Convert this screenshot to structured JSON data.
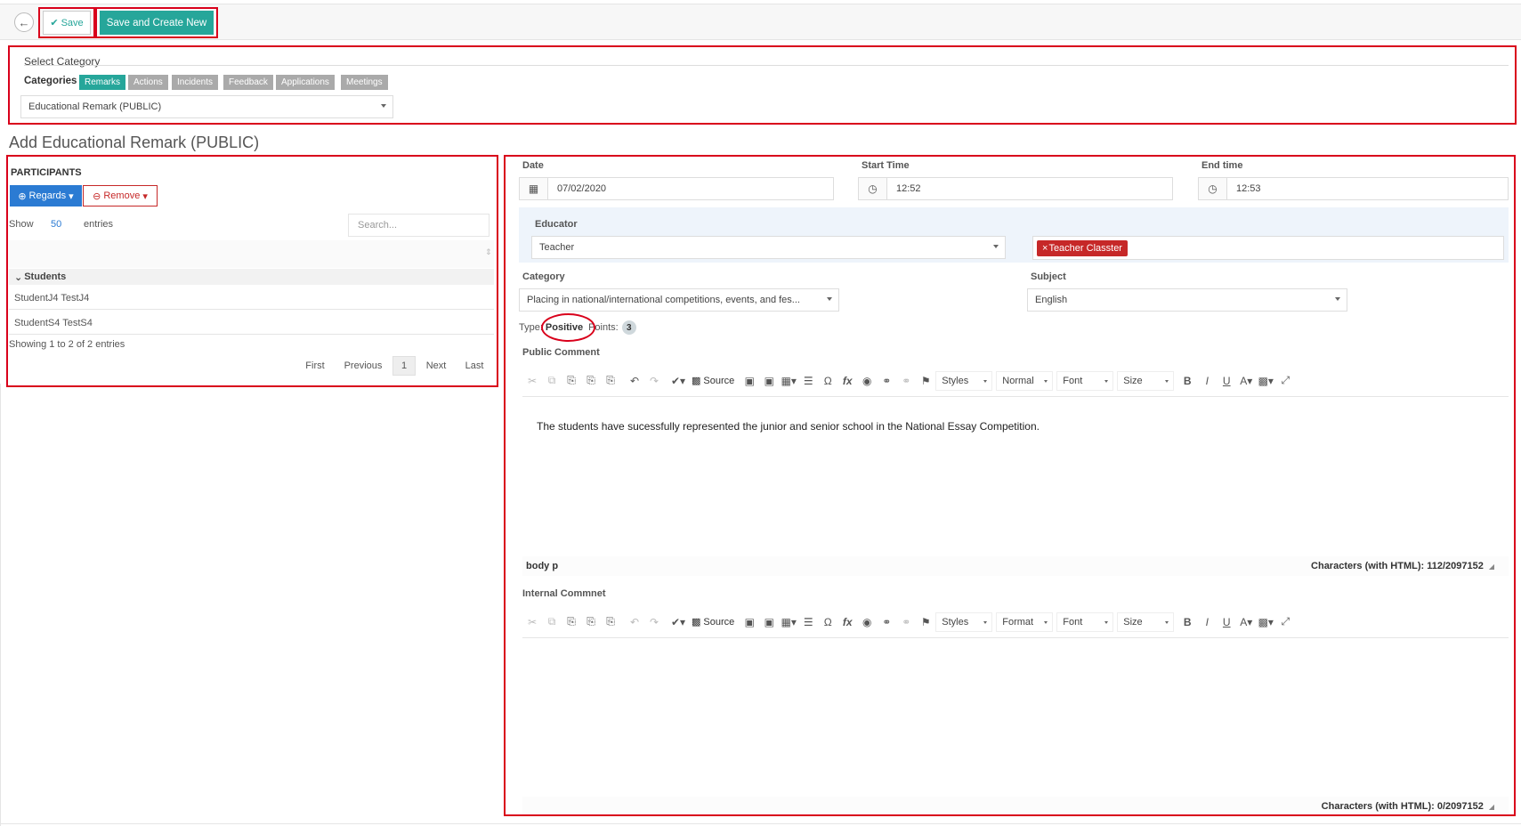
{
  "toolbar": {
    "back_icon": "arrow-left-icon",
    "save_label": "Save",
    "save_new_label": "Save and Create New"
  },
  "category_section": {
    "title": "Select Category",
    "categories_label": "Categories",
    "tabs": [
      "Remarks",
      "Actions",
      "Incidents",
      "Feedback",
      "Applications",
      "Meetings"
    ],
    "active_tab": "Remarks",
    "selected": "Educational Remark (PUBLIC)"
  },
  "page_title": "Add Educational Remark (PUBLIC)",
  "participants": {
    "title": "PARTICIPANTS",
    "regards_label": "Regards",
    "remove_label": "Remove",
    "show_label": "Show",
    "show_value": "50",
    "entries_label": "entries",
    "search_placeholder": "Search...",
    "group": "Students",
    "rows": [
      "StudentJ4 TestJ4",
      "StudentS4 TestS4"
    ],
    "info": "Showing 1 to 2 of 2 entries",
    "pager": {
      "first": "First",
      "previous": "Previous",
      "current": "1",
      "next": "Next",
      "last": "Last"
    }
  },
  "form": {
    "date_label": "Date",
    "date_value": "07/02/2020",
    "start_label": "Start Time",
    "start_value": "12:52",
    "end_label": "End time",
    "end_value": "12:53",
    "educator_label": "Educator",
    "educator_select": "Teacher",
    "educator_chip": "Teacher Classter",
    "category_label": "Category",
    "category_value": "Placing in national/international competitions, events, and fes...",
    "subject_label": "Subject",
    "subject_value": "English",
    "type_label": "Type:",
    "type_value": "Positive",
    "points_label": "Points:",
    "points_value": "3",
    "public_comment_label": "Public Comment",
    "public_comment_text": "The students have sucessfully represented the junior and senior school in the National Essay Competition.",
    "public_status_path": "body  p",
    "public_char_count": "Characters (with HTML): 112/2097152",
    "internal_comment_label": "Internal Commnet",
    "internal_char_count": "Characters (with HTML): 0/2097152"
  },
  "editor_toolbar_public": {
    "source": "Source",
    "styles": "Styles",
    "format": "Normal",
    "font": "Font",
    "size": "Size"
  },
  "editor_toolbar_internal": {
    "source": "Source",
    "styles": "Styles",
    "format": "Format",
    "font": "Font",
    "size": "Size"
  },
  "colors": {
    "accent": "#26a69a",
    "primary": "#2b7bd3",
    "danger": "#c62828",
    "highlight": "#d9001b"
  }
}
